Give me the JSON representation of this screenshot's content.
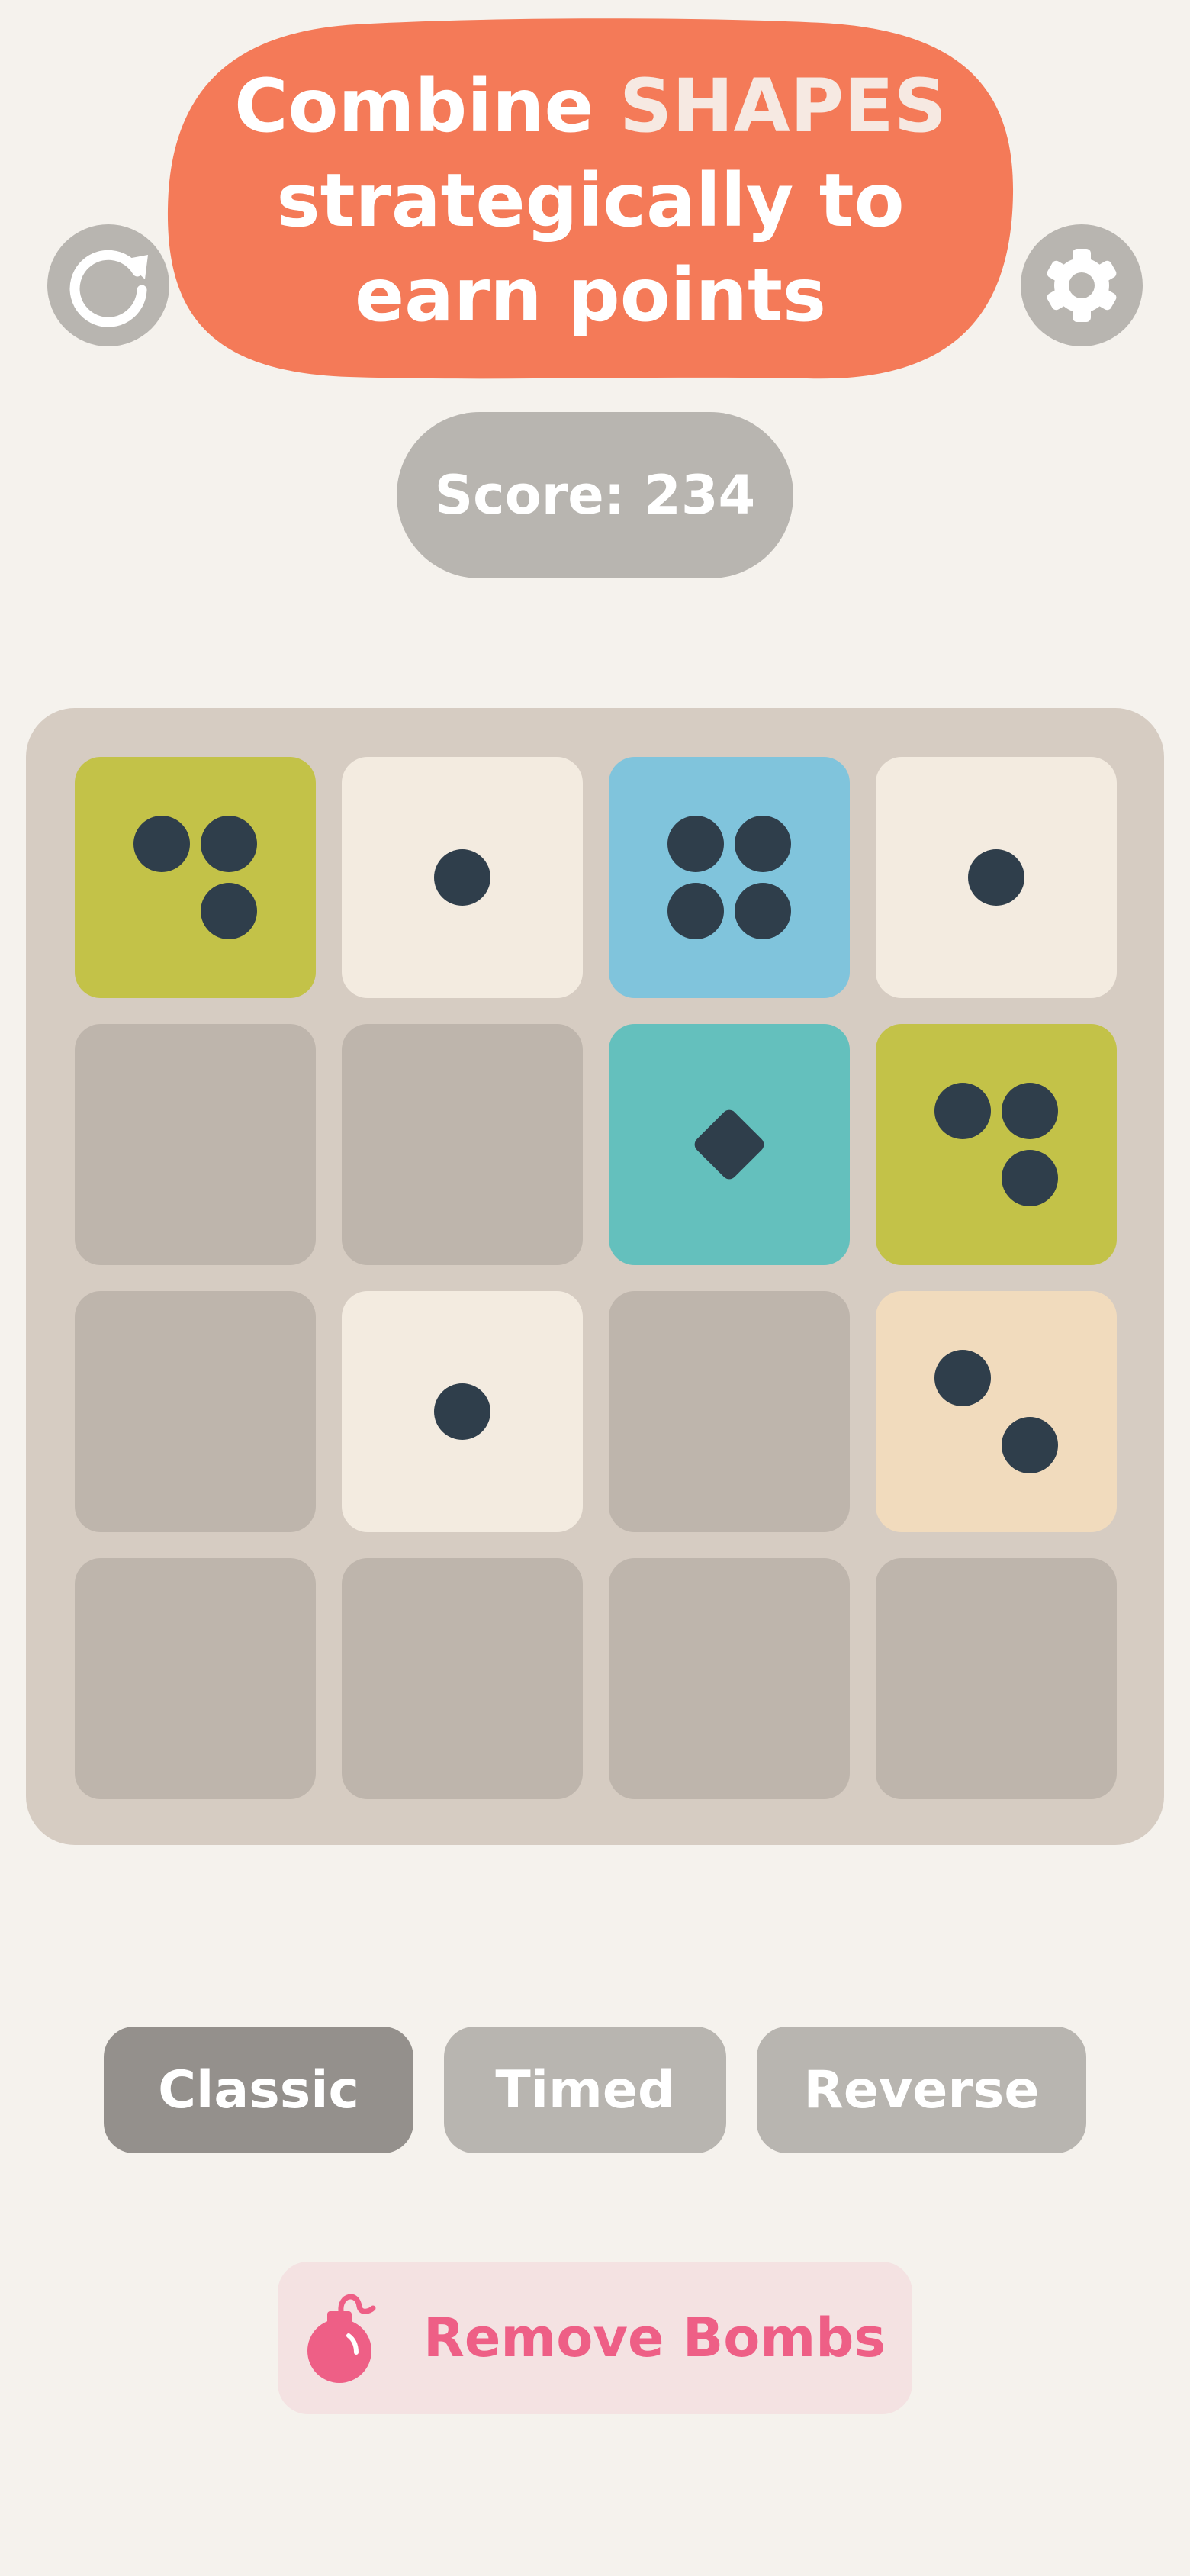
{
  "header": {
    "headline_before": "Combine ",
    "headline_highlight": "SHAPES",
    "headline_after": " strategically to earn points",
    "restart_icon": "restart-icon",
    "settings_icon": "gear-icon"
  },
  "score": {
    "text": "Score: 234"
  },
  "colors": {
    "background": "#f5f2ed",
    "bubble": "#f47a58",
    "button_gray": "#b8b5b0",
    "button_active": "#94908c",
    "board": "#d6ccc2",
    "empty_tile": "#beb5ac",
    "pip": "#2f3e4b",
    "bomb_text": "#ee5f86",
    "bomb_bg": "#f4e2e2"
  },
  "board": {
    "rows": 4,
    "cols": 4,
    "tiles": [
      {
        "row": 0,
        "col": 0,
        "color": "olive",
        "shape": "dots",
        "count": 3
      },
      {
        "row": 0,
        "col": 1,
        "color": "cream",
        "shape": "dots",
        "count": 1
      },
      {
        "row": 0,
        "col": 2,
        "color": "blue",
        "shape": "dots",
        "count": 4
      },
      {
        "row": 0,
        "col": 3,
        "color": "cream",
        "shape": "dots",
        "count": 1
      },
      {
        "row": 1,
        "col": 0,
        "color": "empty"
      },
      {
        "row": 1,
        "col": 1,
        "color": "empty"
      },
      {
        "row": 1,
        "col": 2,
        "color": "teal",
        "shape": "diamond",
        "count": 1
      },
      {
        "row": 1,
        "col": 3,
        "color": "olive",
        "shape": "dots",
        "count": 3
      },
      {
        "row": 2,
        "col": 0,
        "color": "empty"
      },
      {
        "row": 2,
        "col": 1,
        "color": "cream",
        "shape": "dots",
        "count": 1
      },
      {
        "row": 2,
        "col": 2,
        "color": "empty"
      },
      {
        "row": 2,
        "col": 3,
        "color": "peach",
        "shape": "dots",
        "count": 2
      },
      {
        "row": 3,
        "col": 0,
        "color": "empty"
      },
      {
        "row": 3,
        "col": 1,
        "color": "empty"
      },
      {
        "row": 3,
        "col": 2,
        "color": "empty"
      },
      {
        "row": 3,
        "col": 3,
        "color": "empty"
      }
    ]
  },
  "modes": [
    {
      "label": "Classic",
      "active": true
    },
    {
      "label": "Timed",
      "active": false
    },
    {
      "label": "Reverse",
      "active": false
    }
  ],
  "bombs": {
    "label": "Remove Bombs",
    "icon": "bomb-icon"
  }
}
